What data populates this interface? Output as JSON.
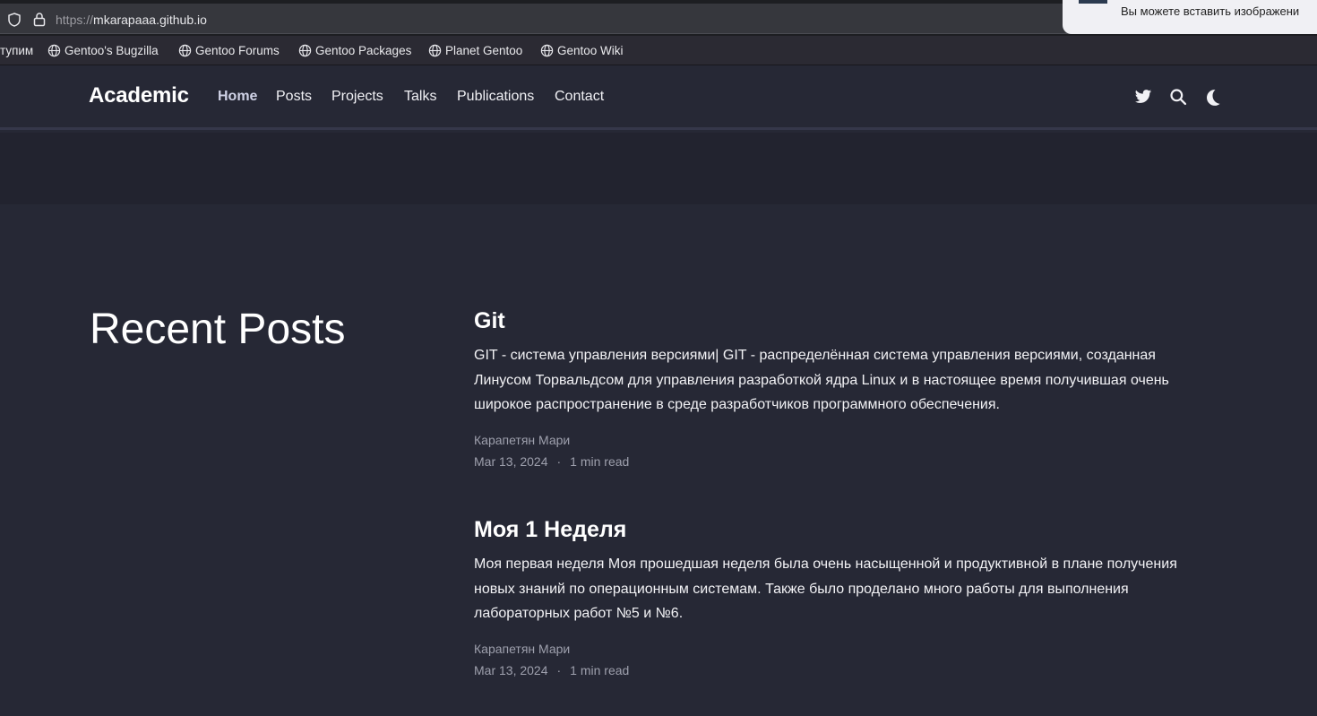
{
  "browser": {
    "url_protocol": "https://",
    "url_host": "mkarapaaa.github.io",
    "notification": "Вы можете вставить изображени",
    "bookmarks": [
      "тупим",
      "Gentoo's Bugzilla",
      "Gentoo Forums",
      "Gentoo Packages",
      "Planet Gentoo",
      "Gentoo Wiki"
    ]
  },
  "nav": {
    "brand": "Academic",
    "links": [
      "Home",
      "Posts",
      "Projects",
      "Talks",
      "Publications",
      "Contact"
    ],
    "active": "Home",
    "icons": [
      "twitter-icon",
      "search-icon",
      "moon-icon"
    ]
  },
  "section": {
    "title": "Recent Posts"
  },
  "posts": [
    {
      "title": "Git",
      "summary": "GIT - система управления версиями| GIT - распределённая система управления версиями, созданная Линусом Торвальдсом для управления разработкой ядра Linux и в настоящее время получившая очень широкое распространение в среде разработчиков программного обеспечения.",
      "author": "Карапетян Мари",
      "date": "Mar 13, 2024",
      "separator": "·",
      "read_time": "1 min read"
    },
    {
      "title": "Моя 1 Неделя",
      "summary": "Моя первая неделя Моя прошедшая неделя была очень насыщенной и продуктивной в плане получения новых знаний по операционным системам. Также было проделано много работы для выполнения лабораторных работ №5 и №6.",
      "author": "Карапетян Мари",
      "date": "Mar 13, 2024",
      "separator": "·",
      "read_time": "1 min read"
    }
  ],
  "colors": {
    "page_bg": "#262835",
    "band_bg": "#22232f",
    "muted_text": "#9ea0ad"
  }
}
